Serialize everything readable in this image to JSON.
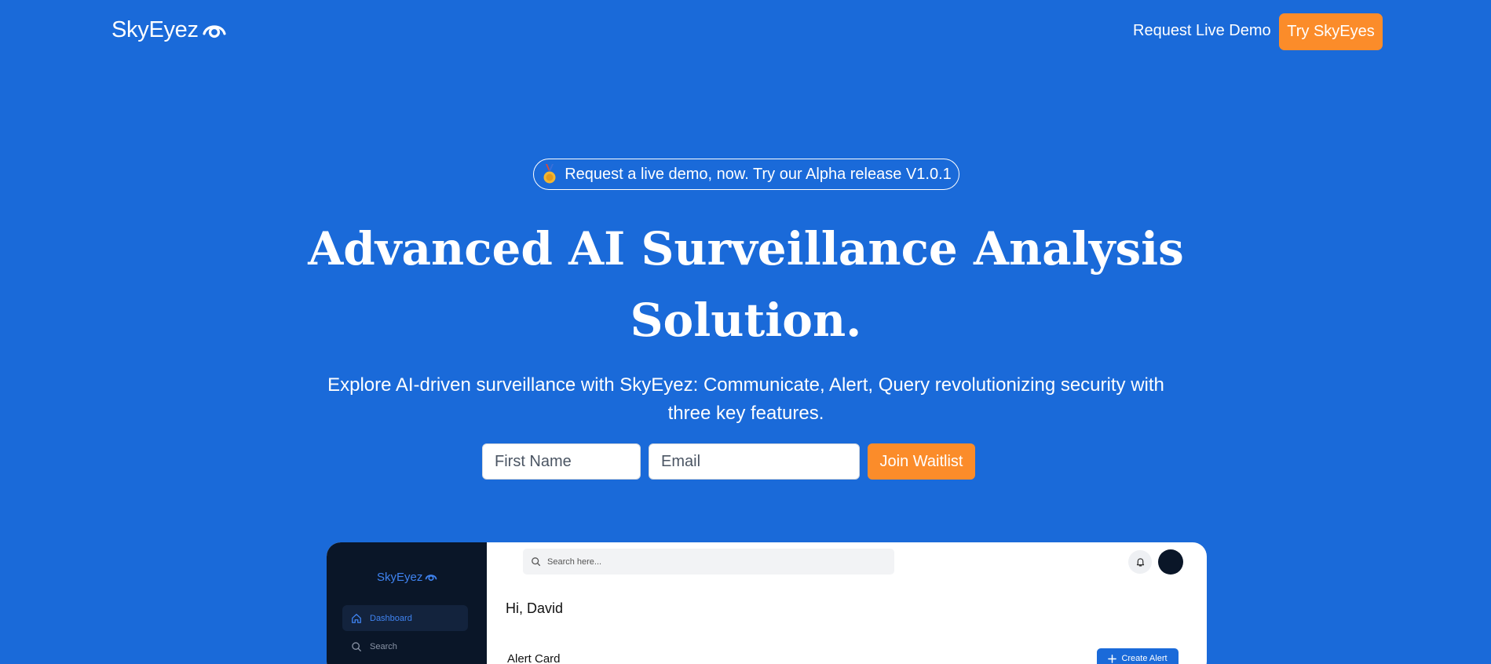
{
  "header": {
    "logo_text": "SkyEyez",
    "demo_link": "Request Live Demo",
    "try_button": "Try SkyEyes"
  },
  "hero": {
    "pill_text": "Request a live demo, now. Try our Alpha release V1.0.1",
    "headline": "Advanced AI Surveillance Analysis Solution.",
    "subtitle": "Explore AI-driven surveillance with SkyEyez: Communicate, Alert, Query revolutionizing security with three key features."
  },
  "waitlist": {
    "first_name_placeholder": "First Name",
    "email_placeholder": "Email",
    "join_label": "Join Waitlist"
  },
  "preview": {
    "logo_text": "SkyEyez",
    "nav": [
      {
        "label": "Dashboard",
        "icon": "home-icon",
        "active": true
      },
      {
        "label": "Search",
        "icon": "search-icon",
        "active": false
      }
    ],
    "search_placeholder": "Search here...",
    "greeting": "Hi, David",
    "card_title": "Alert Card",
    "create_label": "Create Alert"
  },
  "colors": {
    "background": "#1a6ad9",
    "accent_orange": "#fb8c2a",
    "sidebar_dark": "#0a1628",
    "sidebar_active_text": "#3f83f0"
  }
}
